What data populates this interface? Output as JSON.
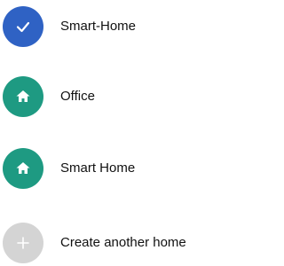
{
  "homes": [
    {
      "label": "Smart-Home",
      "icon": "checkmark-icon",
      "color": "#2F62C4",
      "selected": true
    },
    {
      "label": "Office",
      "icon": "home-icon",
      "color": "#1E9A82",
      "selected": false
    },
    {
      "label": "Smart Home",
      "icon": "home-icon",
      "color": "#1E9A82",
      "selected": false
    }
  ],
  "create": {
    "label": "Create another home",
    "icon": "plus-icon",
    "color": "#D4D4D4"
  }
}
